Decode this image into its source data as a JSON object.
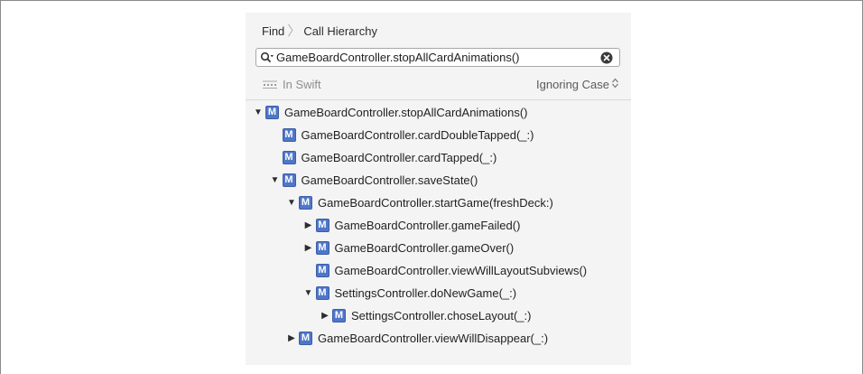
{
  "breadcrumb": {
    "first": "Find",
    "second": "Call Hierarchy"
  },
  "search": {
    "value": "GameBoardController.stopAllCardAnimations()"
  },
  "options": {
    "scope": "In Swift",
    "case_mode": "Ignoring Case"
  },
  "tree": {
    "badge": "M",
    "rows": [
      {
        "label": "GameBoardController.stopAllCardAnimations()",
        "depth": 0,
        "disclosure": "expanded"
      },
      {
        "label": "GameBoardController.cardDoubleTapped(_:)",
        "depth": 1,
        "disclosure": "none"
      },
      {
        "label": "GameBoardController.cardTapped(_:)",
        "depth": 1,
        "disclosure": "none"
      },
      {
        "label": "GameBoardController.saveState()",
        "depth": 1,
        "disclosure": "expanded"
      },
      {
        "label": "GameBoardController.startGame(freshDeck:)",
        "depth": 2,
        "disclosure": "expanded"
      },
      {
        "label": "GameBoardController.gameFailed()",
        "depth": 3,
        "disclosure": "collapsed"
      },
      {
        "label": "GameBoardController.gameOver()",
        "depth": 3,
        "disclosure": "collapsed"
      },
      {
        "label": "GameBoardController.viewWillLayoutSubviews()",
        "depth": 3,
        "disclosure": "none"
      },
      {
        "label": "SettingsController.doNewGame(_:)",
        "depth": 3,
        "disclosure": "expanded"
      },
      {
        "label": "SettingsController.choseLayout(_:)",
        "depth": 4,
        "disclosure": "collapsed"
      },
      {
        "label": "GameBoardController.viewWillDisappear(_:)",
        "depth": 2,
        "disclosure": "collapsed"
      }
    ]
  }
}
